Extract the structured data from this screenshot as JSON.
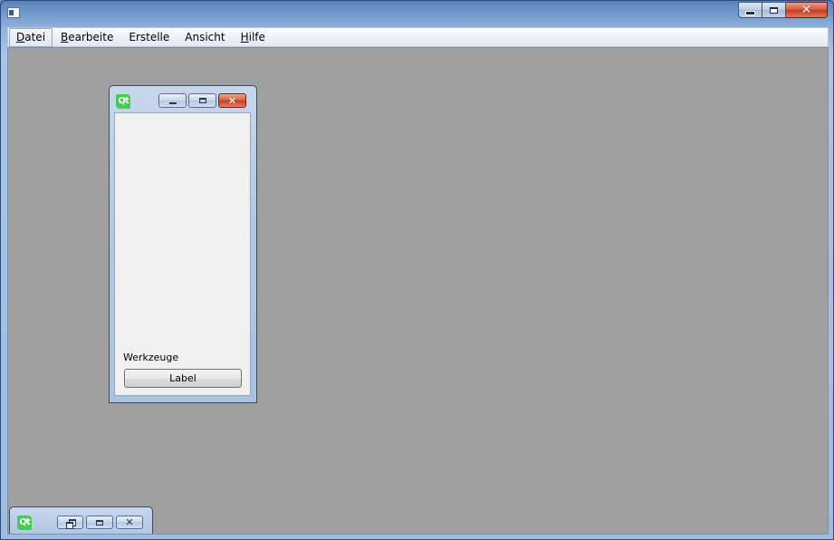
{
  "window": {
    "title": "",
    "caption_buttons": {
      "minimize": "minimize-icon",
      "maximize": "maximize-icon",
      "close": "close-icon"
    }
  },
  "menubar": {
    "items": [
      {
        "label": "Datei",
        "mnemonic": "D",
        "rest": "atei",
        "active": true
      },
      {
        "label": "Bearbeite",
        "mnemonic": "B",
        "rest": "earbeite"
      },
      {
        "label": "Erstelle",
        "mnemonic": "",
        "rest": "Erstelle"
      },
      {
        "label": "Ansicht",
        "mnemonic": "",
        "rest": "Ansicht"
      },
      {
        "label": "Hilfe",
        "mnemonic": "H",
        "rest": "ilfe"
      }
    ]
  },
  "child_window": {
    "logo_text": "Qt",
    "client_label": "Werkzeuge",
    "button_label": "Label"
  },
  "minimized_window": {
    "logo_text": "Qt"
  },
  "colors": {
    "mdi_background": "#a0a0a0",
    "qt_green": "#41cd52",
    "close_red": "#c73c23"
  }
}
